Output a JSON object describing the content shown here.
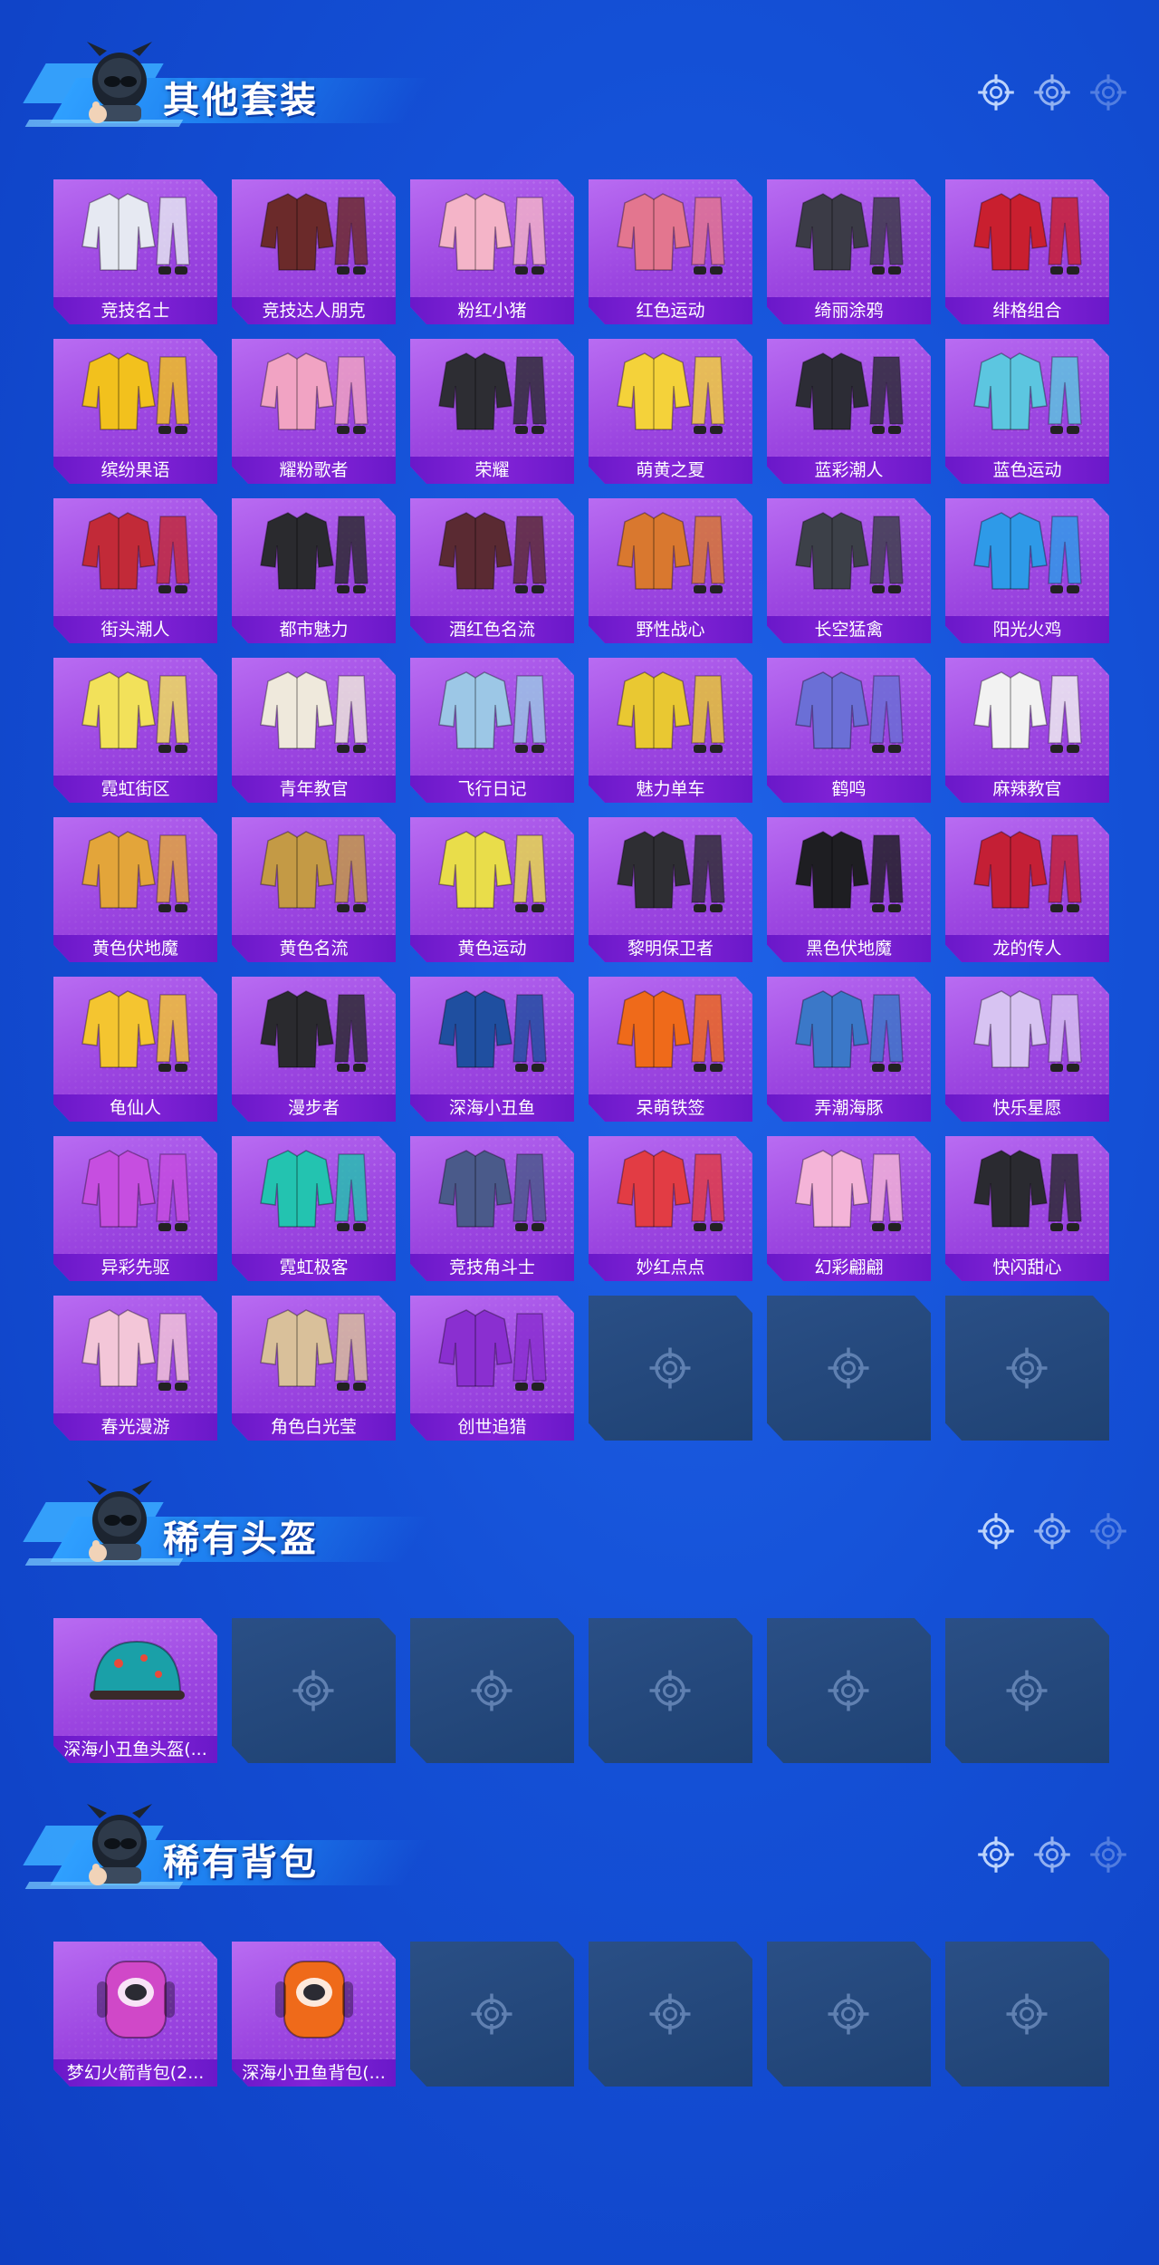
{
  "sections": [
    {
      "title": "其他套装",
      "items": [
        {
          "label": "竞技名士",
          "palette": "#e6e9f2"
        },
        {
          "label": "竞技达人朋克",
          "palette": "#6b2a2a"
        },
        {
          "label": "粉红小猪",
          "palette": "#f4b4c8"
        },
        {
          "label": "红色运动",
          "palette": "#e3768f"
        },
        {
          "label": "绮丽涂鸦",
          "palette": "#3b3b46"
        },
        {
          "label": "绯格组合",
          "palette": "#c91f2f"
        },
        {
          "label": "缤纷果语",
          "palette": "#f2c11d"
        },
        {
          "label": "耀粉歌者",
          "palette": "#f1a3c3"
        },
        {
          "label": "荣耀",
          "palette": "#2d2d33"
        },
        {
          "label": "萌黄之夏",
          "palette": "#f4d23a"
        },
        {
          "label": "蓝彩潮人",
          "palette": "#2c2c35"
        },
        {
          "label": "蓝色运动",
          "palette": "#5cc6e0"
        },
        {
          "label": "街头潮人",
          "palette": "#c22a38"
        },
        {
          "label": "都市魅力",
          "palette": "#2a2a2e"
        },
        {
          "label": "酒红色名流",
          "palette": "#5a2a32"
        },
        {
          "label": "野性战心",
          "palette": "#d9782f"
        },
        {
          "label": "长空猛禽",
          "palette": "#3c4048"
        },
        {
          "label": "阳光火鸡",
          "palette": "#2e9ae8"
        },
        {
          "label": "霓虹街区",
          "palette": "#f2e15a"
        },
        {
          "label": "青年教官",
          "palette": "#efe9dc"
        },
        {
          "label": "飞行日记",
          "palette": "#9cc7e6"
        },
        {
          "label": "魅力单车",
          "palette": "#e9c832"
        },
        {
          "label": "鹤鸣",
          "palette": "#6b6fd6"
        },
        {
          "label": "麻辣教官",
          "palette": "#f2f2f2"
        },
        {
          "label": "黄色伏地魔",
          "palette": "#e3a53a"
        },
        {
          "label": "黄色名流",
          "palette": "#c49a45"
        },
        {
          "label": "黄色运动",
          "palette": "#e9dd4a"
        },
        {
          "label": "黎明保卫者",
          "palette": "#2e2e33"
        },
        {
          "label": "黑色伏地魔",
          "palette": "#1e1e22"
        },
        {
          "label": "龙的传人",
          "palette": "#c41f35"
        },
        {
          "label": "龟仙人",
          "palette": "#f4c530"
        },
        {
          "label": "漫步者",
          "palette": "#2a2a2e"
        },
        {
          "label": "深海小丑鱼",
          "palette": "#1f4fa0"
        },
        {
          "label": "呆萌铁签",
          "palette": "#ef6a1a"
        },
        {
          "label": "弄潮海豚",
          "palette": "#3b78c8"
        },
        {
          "label": "快乐星愿",
          "palette": "#d7c3f2"
        },
        {
          "label": "异彩先驱",
          "palette": "#c64ee0"
        },
        {
          "label": "霓虹极客",
          "palette": "#23c3b0"
        },
        {
          "label": "竞技角斗士",
          "palette": "#4a5a8a"
        },
        {
          "label": "妙红点点",
          "palette": "#e23c44"
        },
        {
          "label": "幻彩翩翩",
          "palette": "#f4b4d8"
        },
        {
          "label": "快闪甜心",
          "palette": "#2a2a30"
        },
        {
          "label": "春光漫游",
          "palette": "#f3c6d8"
        },
        {
          "label": "角色白光莹",
          "palette": "#d9c09a"
        },
        {
          "label": "创世追猎",
          "palette": "#8a2fd0"
        }
      ],
      "empty_slots": 3
    },
    {
      "title": "稀有头盔",
      "items": [
        {
          "label": "深海小丑鱼头盔(...",
          "palette": "#1aa0a8"
        }
      ],
      "empty_slots": 5
    },
    {
      "title": "稀有背包",
      "items": [
        {
          "label": "梦幻火箭背包(2...",
          "palette": "#d048c8"
        },
        {
          "label": "深海小丑鱼背包(...",
          "palette": "#ef6a1a"
        }
      ],
      "empty_slots": 4
    }
  ],
  "icons": {
    "header_reticle": "crosshair-icon",
    "empty_slot": "crosshair-icon",
    "mascot": "mascot-icon"
  },
  "colors": {
    "card_purple": "#9b45e0",
    "label_bar": "#6a18c9",
    "empty_card": "#244a7e",
    "background": "#1450d6"
  }
}
